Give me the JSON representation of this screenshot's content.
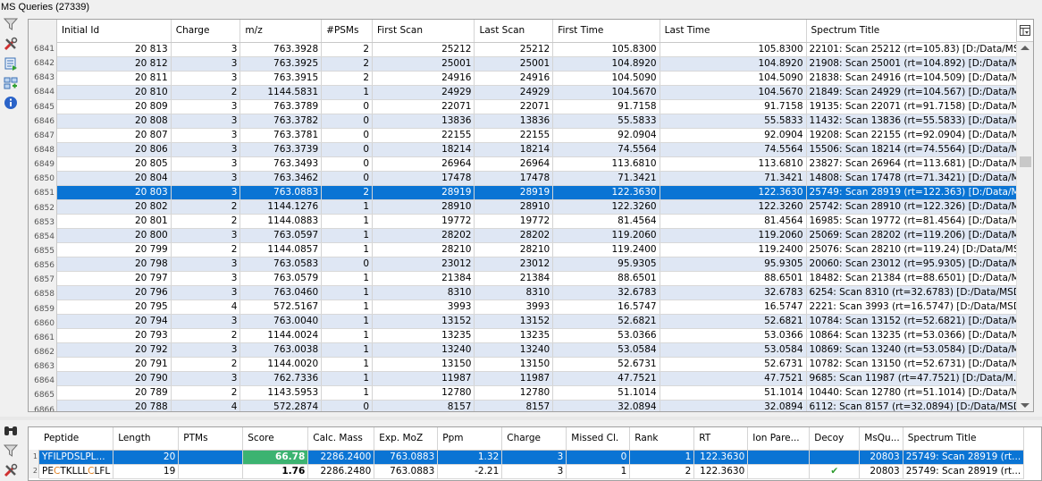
{
  "window": {
    "title": "MS Queries (27339)"
  },
  "side_toolbar": [
    {
      "name": "filter-icon"
    },
    {
      "name": "tools-icon"
    },
    {
      "name": "export-icon"
    },
    {
      "name": "compare-icon"
    },
    {
      "name": "info-icon"
    }
  ],
  "queries": {
    "columns": [
      "Initial Id",
      "Charge",
      "m/z",
      "#PSMs",
      "First Scan",
      "Last Scan",
      "First Time",
      "Last Time",
      "Spectrum Title"
    ],
    "selected_row_index": 10,
    "rows": [
      {
        "num": "6841",
        "cells": [
          "20 813",
          "3",
          "763.3928",
          "2",
          "25212",
          "25212",
          "105.8300",
          "105.8300",
          "22101: Scan 25212 (rt=105.83) [D:/Data/MS..."
        ]
      },
      {
        "num": "6842",
        "cells": [
          "20 812",
          "3",
          "763.3925",
          "2",
          "25001",
          "25001",
          "104.8920",
          "104.8920",
          "21908: Scan 25001 (rt=104.892) [D:/Data/M..."
        ]
      },
      {
        "num": "6843",
        "cells": [
          "20 811",
          "3",
          "763.3915",
          "2",
          "24916",
          "24916",
          "104.5090",
          "104.5090",
          "21838: Scan 24916 (rt=104.509) [D:/Data/M..."
        ]
      },
      {
        "num": "6844",
        "cells": [
          "20 810",
          "2",
          "1144.5831",
          "1",
          "24929",
          "24929",
          "104.5670",
          "104.5670",
          "21849: Scan 24929 (rt=104.567) [D:/Data/M..."
        ]
      },
      {
        "num": "6845",
        "cells": [
          "20 809",
          "3",
          "763.3789",
          "0",
          "22071",
          "22071",
          "91.7158",
          "91.7158",
          "19135: Scan 22071 (rt=91.7158) [D:/Data/M..."
        ]
      },
      {
        "num": "6846",
        "cells": [
          "20 808",
          "3",
          "763.3782",
          "0",
          "13836",
          "13836",
          "55.5833",
          "55.5833",
          "11432: Scan 13836 (rt=55.5833) [D:/Data/M..."
        ]
      },
      {
        "num": "6847",
        "cells": [
          "20 807",
          "3",
          "763.3781",
          "0",
          "22155",
          "22155",
          "92.0904",
          "92.0904",
          "19208: Scan 22155 (rt=92.0904) [D:/Data/M..."
        ]
      },
      {
        "num": "6848",
        "cells": [
          "20 806",
          "3",
          "763.3739",
          "0",
          "18214",
          "18214",
          "74.5564",
          "74.5564",
          "15506: Scan 18214 (rt=74.5564) [D:/Data/M..."
        ]
      },
      {
        "num": "6849",
        "cells": [
          "20 805",
          "3",
          "763.3493",
          "0",
          "26964",
          "26964",
          "113.6810",
          "113.6810",
          "23827: Scan 26964 (rt=113.681) [D:/Data/M..."
        ]
      },
      {
        "num": "6850",
        "cells": [
          "20 804",
          "3",
          "763.3462",
          "0",
          "17478",
          "17478",
          "71.3421",
          "71.3421",
          "14808: Scan 17478 (rt=71.3421) [D:/Data/M..."
        ]
      },
      {
        "num": "6851",
        "cells": [
          "20 803",
          "3",
          "763.0883",
          "2",
          "28919",
          "28919",
          "122.3630",
          "122.3630",
          "25749: Scan 28919 (rt=122.363) [D:/Data/M..."
        ]
      },
      {
        "num": "6852",
        "cells": [
          "20 802",
          "2",
          "1144.1276",
          "1",
          "28910",
          "28910",
          "122.3260",
          "122.3260",
          "25742: Scan 28910 (rt=122.326) [D:/Data/M..."
        ]
      },
      {
        "num": "6853",
        "cells": [
          "20 801",
          "2",
          "1144.0883",
          "1",
          "19772",
          "19772",
          "81.4564",
          "81.4564",
          "16985: Scan 19772 (rt=81.4564) [D:/Data/M..."
        ]
      },
      {
        "num": "6854",
        "cells": [
          "20 800",
          "3",
          "763.0597",
          "1",
          "28202",
          "28202",
          "119.2060",
          "119.2060",
          "25069: Scan 28202 (rt=119.206) [D:/Data/M..."
        ]
      },
      {
        "num": "6855",
        "cells": [
          "20 799",
          "2",
          "1144.0857",
          "1",
          "28210",
          "28210",
          "119.2400",
          "119.2400",
          "25076: Scan 28210 (rt=119.24) [D:/Data/MS..."
        ]
      },
      {
        "num": "6856",
        "cells": [
          "20 798",
          "3",
          "763.0583",
          "0",
          "23012",
          "23012",
          "95.9305",
          "95.9305",
          "20060: Scan 23012 (rt=95.9305) [D:/Data/M..."
        ]
      },
      {
        "num": "6857",
        "cells": [
          "20 797",
          "3",
          "763.0579",
          "1",
          "21384",
          "21384",
          "88.6501",
          "88.6501",
          "18482: Scan 21384 (rt=88.6501) [D:/Data/M..."
        ]
      },
      {
        "num": "6858",
        "cells": [
          "20 796",
          "3",
          "763.0460",
          "1",
          "8310",
          "8310",
          "32.6783",
          "32.6783",
          "6254: Scan 8310 (rt=32.6783) [D:/Data/MSD..."
        ]
      },
      {
        "num": "6859",
        "cells": [
          "20 795",
          "4",
          "572.5167",
          "1",
          "3993",
          "3993",
          "16.5747",
          "16.5747",
          "2221: Scan 3993 (rt=16.5747) [D:/Data/MSD..."
        ]
      },
      {
        "num": "6860",
        "cells": [
          "20 794",
          "3",
          "763.0040",
          "1",
          "13152",
          "13152",
          "52.6821",
          "52.6821",
          "10784: Scan 13152 (rt=52.6821) [D:/Data/M..."
        ]
      },
      {
        "num": "6861",
        "cells": [
          "20 793",
          "2",
          "1144.0024",
          "1",
          "13235",
          "13235",
          "53.0366",
          "53.0366",
          "10864: Scan 13235 (rt=53.0366) [D:/Data/M..."
        ]
      },
      {
        "num": "6862",
        "cells": [
          "20 792",
          "3",
          "763.0038",
          "1",
          "13240",
          "13240",
          "53.0584",
          "53.0584",
          "10869: Scan 13240 (rt=53.0584) [D:/Data/M..."
        ]
      },
      {
        "num": "6863",
        "cells": [
          "20 791",
          "2",
          "1144.0020",
          "1",
          "13150",
          "13150",
          "52.6731",
          "52.6731",
          "10782: Scan 13150 (rt=52.6731) [D:/Data/M..."
        ]
      },
      {
        "num": "6864",
        "cells": [
          "20 790",
          "3",
          "762.7336",
          "1",
          "11987",
          "11987",
          "47.7521",
          "47.7521",
          "9685: Scan 11987 (rt=47.7521) [D:/Data/M..."
        ]
      },
      {
        "num": "6865",
        "cells": [
          "20 789",
          "2",
          "1143.5953",
          "1",
          "12780",
          "12780",
          "51.1014",
          "51.1014",
          "10440: Scan 12780 (rt=51.1014) [D:/Data/M..."
        ]
      },
      {
        "num": "6866",
        "cells": [
          "20 788",
          "4",
          "572.2874",
          "0",
          "8157",
          "8157",
          "32.0894",
          "32.0894",
          "6112: Scan 8157 (rt=32.0894) [D:/Data/MSD..."
        ]
      }
    ]
  },
  "psms": {
    "toolbar": [
      {
        "name": "binoculars-icon"
      },
      {
        "name": "filter-icon"
      },
      {
        "name": "tools-icon"
      }
    ],
    "columns": [
      "Peptide",
      "Length",
      "PTMs",
      "Score",
      "Calc. Mass",
      "Exp. MoZ",
      "Ppm",
      "Charge",
      "Missed Cl.",
      "Rank",
      "RT",
      "Ion Pare...",
      "Decoy",
      "MsQu...",
      "Spectrum Title"
    ],
    "rows": [
      {
        "num": "1",
        "peptide": "YFILPDSLPL...",
        "cells": [
          "20",
          "",
          "66.78",
          "2286.2400",
          "763.0883",
          "1.32",
          "3",
          "0",
          "1",
          "122.3630",
          "",
          "",
          "20803",
          "25749: Scan 28919 (rt..."
        ],
        "selected": true
      },
      {
        "num": "2",
        "peptide_parts": [
          "PE",
          "C",
          "TKLLL",
          "C",
          "LFL"
        ],
        "cells": [
          "19",
          "",
          "1.76",
          "2286.2480",
          "763.0883",
          "-2.21",
          "3",
          "1",
          "2",
          "122.3630",
          "",
          "✔",
          "20803",
          "25749: Scan 28919 (rt..."
        ],
        "selected": false
      }
    ]
  },
  "colors": {
    "selection": "#0a74d4",
    "alt_row": "#dfe7f4",
    "score_high": "#3cb371",
    "decoy_check": "#2e9b2e",
    "ptm_highlight": "#e08020"
  }
}
